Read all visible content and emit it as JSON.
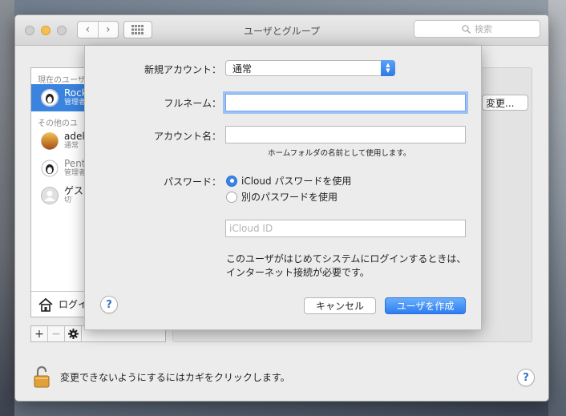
{
  "window": {
    "title": "ユーザとグループ",
    "search_placeholder": "検索",
    "nav_back": "‹",
    "nav_forward": "›"
  },
  "user_list": {
    "current_section": "現在のユーザ",
    "other_section": "その他のユ",
    "users": [
      {
        "name": "Rock",
        "role": "管理者",
        "selected": true,
        "icon": "penguin-avatar"
      },
      {
        "name": "adel",
        "role": "通常",
        "selected": false,
        "icon": "sunset-avatar"
      },
      {
        "name": "Pent",
        "role": "管理者",
        "selected": false,
        "icon": "penguin-avatar"
      },
      {
        "name": "ゲス",
        "role": "切",
        "selected": false,
        "icon": "guest-avatar"
      }
    ],
    "login_label": "ログイ",
    "add": "+",
    "remove": "−"
  },
  "right_pane": {
    "change_button": "変更..."
  },
  "lock": {
    "text": "変更できないようにするにはカギをクリックします。"
  },
  "sheet": {
    "new_account_label": "新規アカウント：",
    "new_account_value": "通常",
    "fullname_label": "フルネーム：",
    "fullname_value": "",
    "account_name_label": "アカウント名：",
    "account_name_value": "",
    "account_hint": "ホームフォルダの名前として使用します。",
    "password_label": "パスワード：",
    "password_options": [
      {
        "label": "iCloud パスワードを使用",
        "selected": true
      },
      {
        "label": "別のパスワードを使用",
        "selected": false
      }
    ],
    "icloud_id_placeholder": "iCloud ID",
    "note": "このユーザがはじめてシステムにログインするときは、インターネット接続が必要です。",
    "cancel": "キャンセル",
    "create": "ユーザを作成",
    "help": "?"
  },
  "colors": {
    "accent": "#3a84e8",
    "minimize": "#f5bf4f"
  }
}
